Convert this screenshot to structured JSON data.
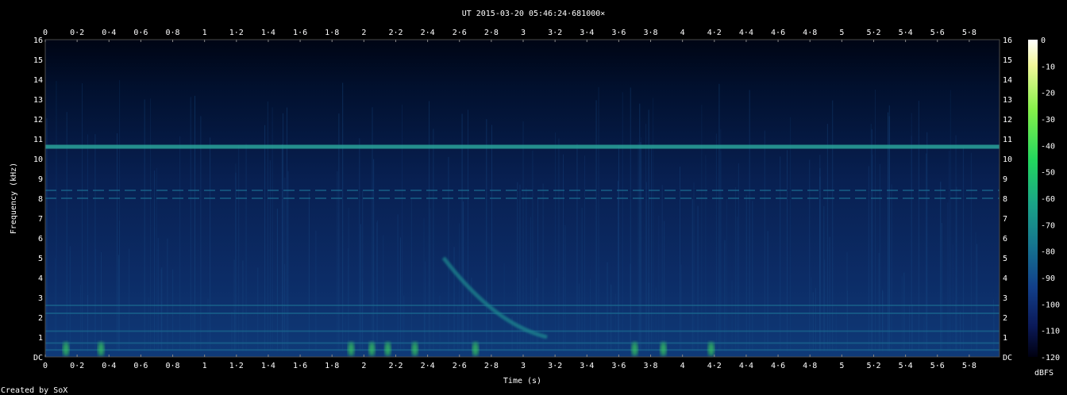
{
  "chart_data": {
    "type": "heatmap",
    "title": "UT 2015-03-20 05:46:24·681000×",
    "xlabel": "Time (s)",
    "ylabel": "Frequency (kHz)",
    "xlim": [
      0,
      5.99
    ],
    "ylim": [
      0,
      16
    ],
    "x_ticks": [
      "0",
      "0·2",
      "0·4",
      "0·6",
      "0·8",
      "1",
      "1·2",
      "1·4",
      "1·6",
      "1·8",
      "2",
      "2·2",
      "2·4",
      "2·6",
      "2·8",
      "3",
      "3·2",
      "3·4",
      "3·6",
      "3·8",
      "4",
      "4·2",
      "4·4",
      "4·6",
      "4·8",
      "5",
      "5·2",
      "5·4",
      "5·6",
      "5·8"
    ],
    "x_tick_values": [
      0,
      0.2,
      0.4,
      0.6,
      0.8,
      1.0,
      1.2,
      1.4,
      1.6,
      1.8,
      2.0,
      2.2,
      2.4,
      2.6,
      2.8,
      3.0,
      3.2,
      3.4,
      3.6,
      3.8,
      4.0,
      4.2,
      4.4,
      4.6,
      4.8,
      5.0,
      5.2,
      5.4,
      5.6,
      5.8
    ],
    "y_ticks": [
      "DC",
      "1",
      "2",
      "3",
      "4",
      "5",
      "6",
      "7",
      "8",
      "9",
      "10",
      "11",
      "12",
      "13",
      "14",
      "15",
      "16"
    ],
    "y_tick_values": [
      0,
      1,
      2,
      3,
      4,
      5,
      6,
      7,
      8,
      9,
      10,
      11,
      12,
      13,
      14,
      15,
      16
    ],
    "colorbar": {
      "label": "dBFS",
      "ticks": [
        "0",
        "-10",
        "-20",
        "-30",
        "-40",
        "-50",
        "-60",
        "-70",
        "-80",
        "-90",
        "-100",
        "-110",
        "-120"
      ],
      "range": [
        -120,
        0
      ]
    },
    "colors": {
      "background": "#000000",
      "noise_floor": "#0b2a66",
      "feature": "#1f9e8c",
      "strong": "#3ee05a"
    },
    "features": {
      "horizontal_tones_khz": [
        10.6,
        8.4,
        8.0,
        2.6,
        2.2,
        1.3,
        0.7,
        0.35
      ],
      "vertical_bursts": [
        {
          "t": 0.13,
          "f_low": 0,
          "f_high": 15.2,
          "level": -55
        },
        {
          "t": 0.16,
          "f_low": 0,
          "f_high": 13.8,
          "level": -65
        },
        {
          "t": 0.4,
          "f_low": 2,
          "f_high": 14.0,
          "level": -75
        },
        {
          "t": 0.47,
          "f_low": 2,
          "f_high": 14.2,
          "level": -75
        },
        {
          "t": 2.7,
          "f_low": 0,
          "f_high": 3.0,
          "level": -60
        },
        {
          "t": 3.7,
          "f_low": 3.8,
          "f_high": 14.8,
          "level": -65
        },
        {
          "t": 4.18,
          "f_low": 0.5,
          "f_high": 14.5,
          "level": -72
        },
        {
          "t": 4.75,
          "f_low": 4.5,
          "f_high": 14.5,
          "level": -75
        },
        {
          "t": 5.08,
          "f_low": 4.8,
          "f_high": 14.0,
          "level": -78
        },
        {
          "t": 5.65,
          "f_low": 7.0,
          "f_high": 14.5,
          "level": -78
        }
      ],
      "dispersive_whistler": {
        "t_start": 2.5,
        "f_start": 5.0,
        "t_end": 3.15,
        "f_end": 1.0
      }
    },
    "footer": "Created by SoX"
  }
}
